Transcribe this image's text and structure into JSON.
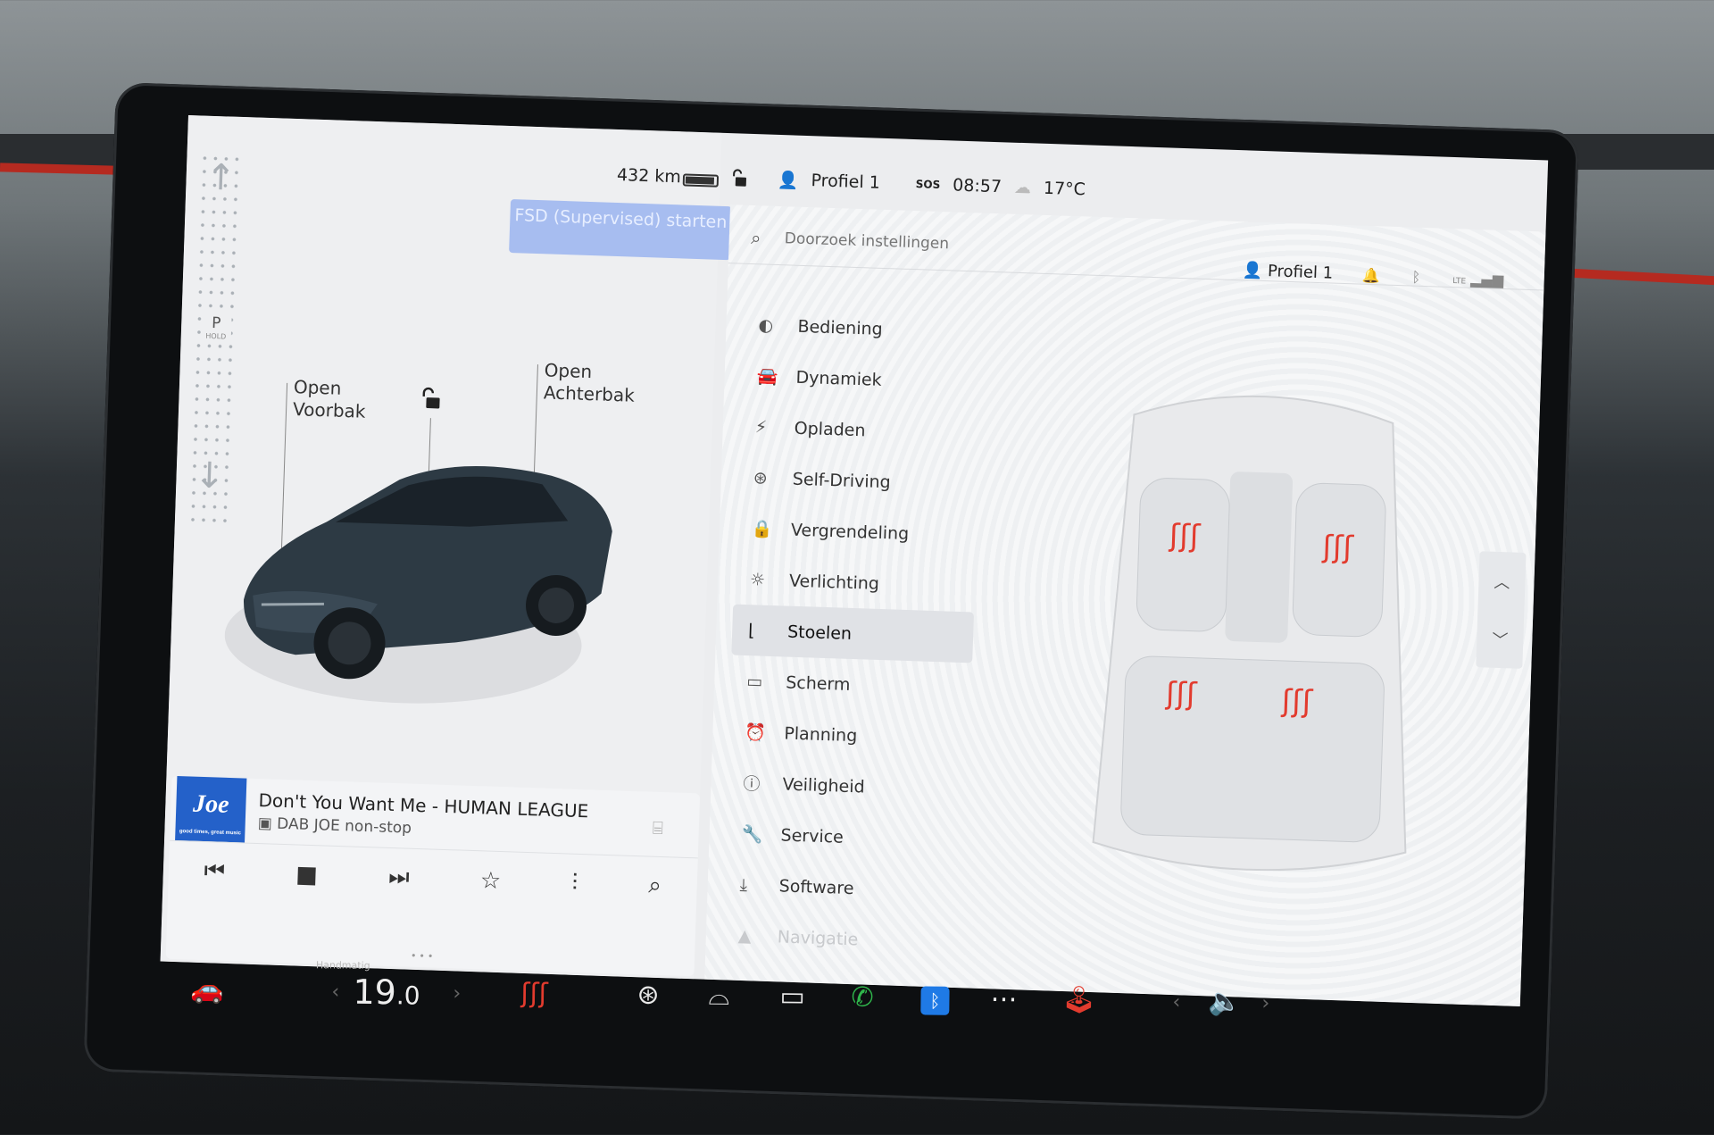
{
  "status": {
    "range": "432 km",
    "profile": "Profiel 1",
    "sos": "SOS",
    "time": "08:57",
    "temperature": "17°C"
  },
  "left_panel": {
    "fsd_button": "FSD (Supervised) starten",
    "gear": {
      "selected": "P",
      "hold": "HOLD"
    },
    "frunk": {
      "line1": "Open",
      "line2": "Voorbak"
    },
    "trunk": {
      "line1": "Open",
      "line2": "Achterbak"
    }
  },
  "media": {
    "station_logo": "Joe",
    "logo_tagline": "good times, great music",
    "song": "Don't You Want Me - HUMAN LEAGUE",
    "station": "DAB JOE non-stop"
  },
  "settings": {
    "search_placeholder": "Doorzoek instellingen",
    "profile": "Profiel 1",
    "signal": "LTE",
    "menu": [
      {
        "label": "Bediening",
        "icon": "toggle-icon"
      },
      {
        "label": "Dynamiek",
        "icon": "car-icon"
      },
      {
        "label": "Opladen",
        "icon": "bolt-icon"
      },
      {
        "label": "Self-Driving",
        "icon": "steering-wheel-icon"
      },
      {
        "label": "Vergrendeling",
        "icon": "lock-icon"
      },
      {
        "label": "Verlichting",
        "icon": "sun-icon"
      },
      {
        "label": "Stoelen",
        "icon": "seat-icon",
        "active": true
      },
      {
        "label": "Scherm",
        "icon": "display-icon"
      },
      {
        "label": "Planning",
        "icon": "alarm-clock-icon"
      },
      {
        "label": "Veiligheid",
        "icon": "alert-circle-icon"
      },
      {
        "label": "Service",
        "icon": "wrench-icon"
      },
      {
        "label": "Software",
        "icon": "download-icon"
      },
      {
        "label": "Navigatie",
        "icon": "navigation-icon"
      }
    ]
  },
  "taskbar": {
    "temp_mode": "Handmatig",
    "temp_value": "19",
    "temp_decimal": ".0"
  },
  "colors": {
    "fsd_button": "#a7bdf0",
    "heat_active": "#e23b2e",
    "bluetooth": "#1f7ae6",
    "phone": "#2fb54b",
    "station_logo": "#2461c9"
  }
}
